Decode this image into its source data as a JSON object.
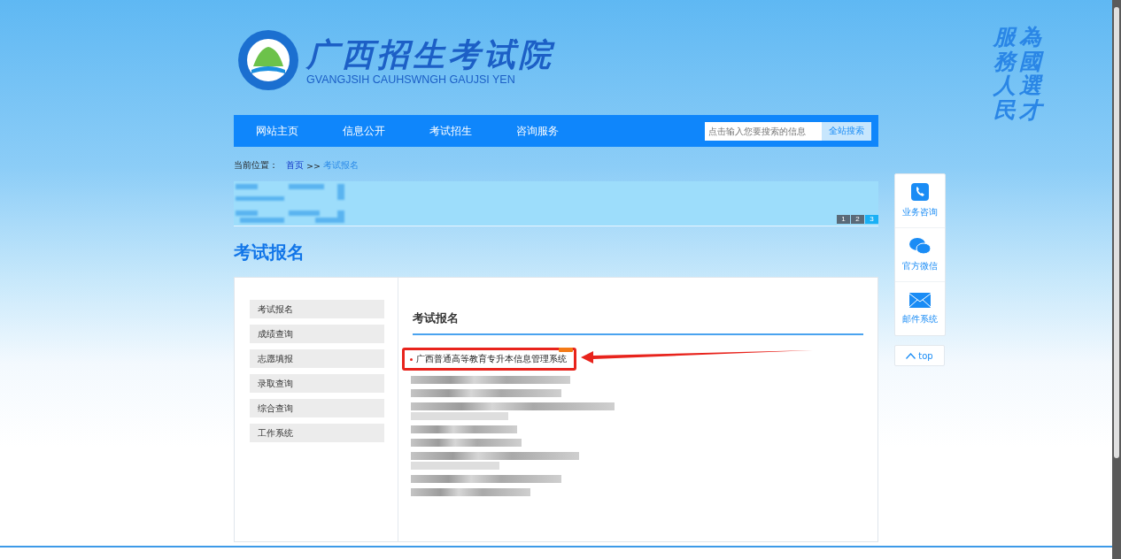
{
  "header": {
    "title": "广西招生考试院",
    "subtitle": "GVANGJSIH CAUHSWNGH GAUJSI YEN",
    "motto_columns": [
      "服務人民",
      "為國選才"
    ]
  },
  "nav": {
    "items": [
      {
        "label": "网站主页"
      },
      {
        "label": "信息公开"
      },
      {
        "label": "考试招生"
      },
      {
        "label": "咨询服务"
      }
    ],
    "search": {
      "placeholder": "点击输入您要搜索的信息",
      "button": "全站搜索"
    }
  },
  "breadcrumb": {
    "label": "当前位置：",
    "items": [
      {
        "label": "首页",
        "kind": "link"
      },
      {
        "label": ">>",
        "kind": "sep"
      },
      {
        "label": "考试报名",
        "kind": "current"
      }
    ]
  },
  "banner": {
    "pages": [
      {
        "label": "1",
        "selected": false
      },
      {
        "label": "2",
        "selected": false
      },
      {
        "label": "3",
        "selected": true
      }
    ]
  },
  "page_title": "考试报名",
  "sidebar": {
    "items": [
      {
        "label": "考试报名"
      },
      {
        "label": "成绩查询"
      },
      {
        "label": "志愿填报"
      },
      {
        "label": "录取查询"
      },
      {
        "label": "综合查询"
      },
      {
        "label": "工作系统"
      }
    ]
  },
  "content": {
    "title": "考试报名",
    "items": [
      {
        "kind": "link",
        "label": "广西普通高等教育专升本信息管理系统",
        "hot": true,
        "highlighted": true
      },
      {
        "kind": "redacted"
      },
      {
        "kind": "redacted"
      },
      {
        "kind": "redacted"
      },
      {
        "kind": "redacted"
      },
      {
        "kind": "redacted"
      },
      {
        "kind": "redacted"
      },
      {
        "kind": "redacted"
      },
      {
        "kind": "redacted"
      }
    ]
  },
  "float_bar": {
    "items": [
      {
        "label": "业务咨询",
        "kind": "phone"
      },
      {
        "label": "官方微信",
        "kind": "wechat"
      },
      {
        "label": "邮件系统",
        "kind": "mail"
      }
    ],
    "top": "top"
  }
}
